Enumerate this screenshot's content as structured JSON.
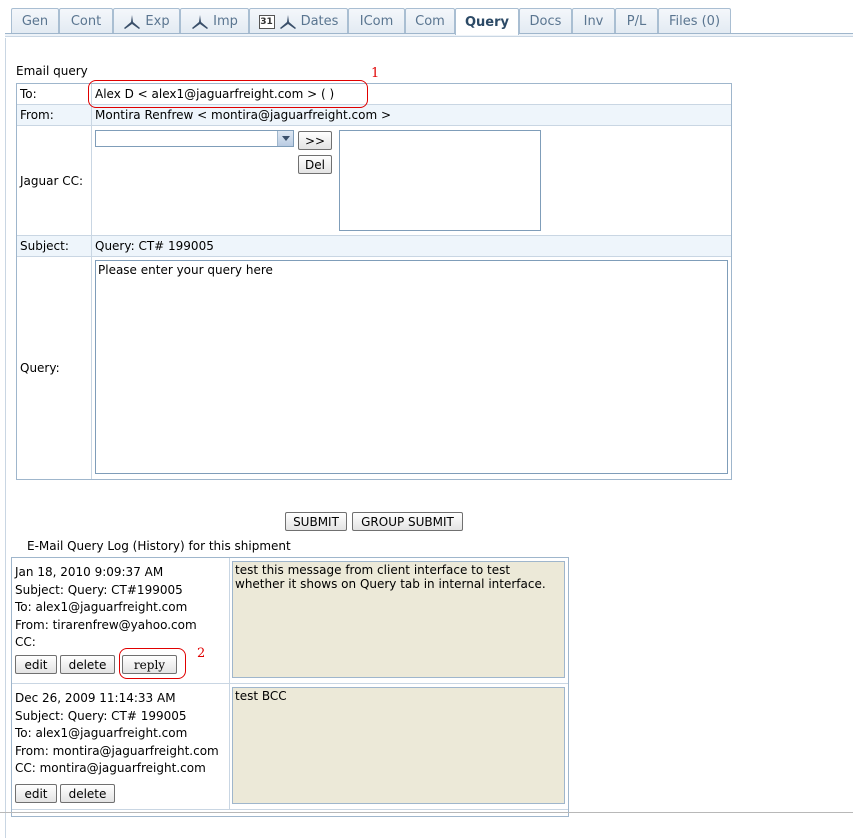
{
  "tabs": [
    {
      "label": "Gen",
      "icon": ""
    },
    {
      "label": "Cont",
      "icon": ""
    },
    {
      "label": "Exp",
      "icon": "plane-icon"
    },
    {
      "label": "Imp",
      "icon": "plane-icon"
    },
    {
      "label": "Dates",
      "icon": "calendar-plane-icon",
      "cal_text": "31"
    },
    {
      "label": "ICom",
      "icon": ""
    },
    {
      "label": "Com",
      "icon": ""
    },
    {
      "label": "Query",
      "icon": ""
    },
    {
      "label": "Docs",
      "icon": ""
    },
    {
      "label": "Inv",
      "icon": ""
    },
    {
      "label": "P/L",
      "icon": ""
    },
    {
      "label": "Files (0)",
      "icon": ""
    }
  ],
  "active_tab": "Query",
  "email_query": {
    "caption": "Email query",
    "to_label": "To:",
    "to_value": "Alex D < alex1@jaguarfreight.com > ( )",
    "from_label": "From:",
    "from_value": "Montira Renfrew < montira@jaguarfreight.com >",
    "cc_label": "Jaguar CC:",
    "cc_select_value": "",
    "add_button": ">>",
    "del_button": "Del",
    "subject_label": "Subject:",
    "subject_value": "Query: CT# 199005",
    "query_label": "Query:",
    "query_text": "Please enter your query here"
  },
  "actions": {
    "submit": "SUBMIT",
    "group_submit": "GROUP SUBMIT"
  },
  "log": {
    "caption": "E-Mail Query Log (History) for this shipment",
    "entries": [
      {
        "date": "Jan 18, 2010 9:09:37 AM",
        "subject": "Subject: Query: CT#199005",
        "to": "To: alex1@jaguarfreight.com",
        "from": "From: tirarenfrew@yahoo.com",
        "cc": "CC:",
        "message": "test this message from client interface to test whether it shows on Query tab in internal interface.",
        "edit": "edit",
        "delete": "delete",
        "reply": "reply"
      },
      {
        "date": "Dec 26, 2009 11:14:33 AM",
        "subject": "Subject: Query: CT# 199005",
        "to": "To: alex1@jaguarfreight.com",
        "from": "From: montira@jaguarfreight.com",
        "cc": "CC: montira@jaguarfreight.com",
        "message": "test BCC",
        "edit": "edit",
        "delete": "delete"
      }
    ]
  },
  "annotations": {
    "one": "1",
    "two": "2"
  },
  "colors": {
    "annotation": "#e00000",
    "tab_text": "#5a7590",
    "tab_border": "#a9bed2",
    "row_alt": "#eef5fb",
    "message_bg": "#ece9d8"
  }
}
